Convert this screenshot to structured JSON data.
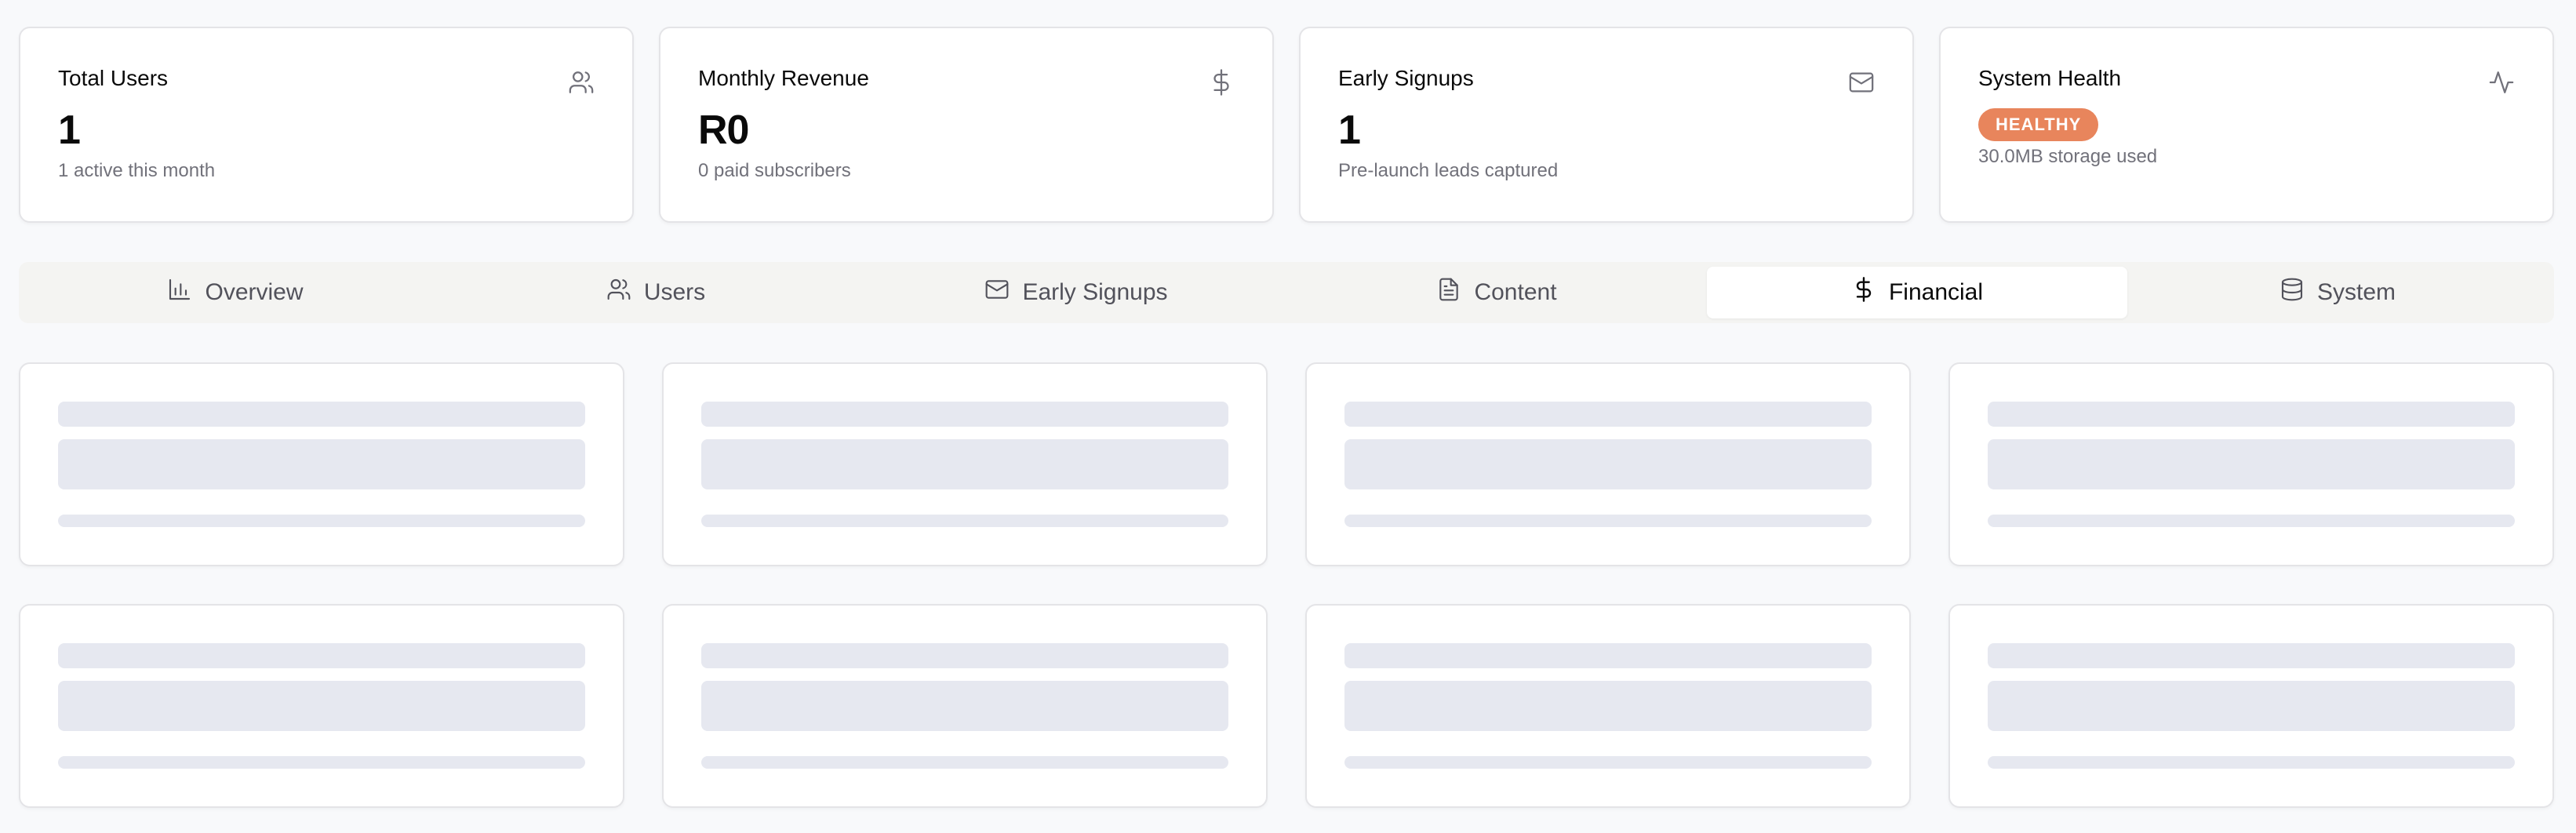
{
  "stats": [
    {
      "title": "Total Users",
      "value": "1",
      "sub": "1 active this month",
      "icon": "users-icon"
    },
    {
      "title": "Monthly Revenue",
      "value": "R0",
      "sub": "0 paid subscribers",
      "icon": "dollar-icon"
    },
    {
      "title": "Early Signups",
      "value": "1",
      "sub": "Pre-launch leads captured",
      "icon": "mail-icon"
    },
    {
      "title": "System Health",
      "badge": "HEALTHY",
      "sub": "30.0MB storage used",
      "icon": "activity-icon"
    }
  ],
  "tabs": [
    {
      "label": "Overview",
      "icon": "bar-chart-icon"
    },
    {
      "label": "Users",
      "icon": "users-icon"
    },
    {
      "label": "Early Signups",
      "icon": "mail-icon"
    },
    {
      "label": "Content",
      "icon": "file-text-icon"
    },
    {
      "label": "Financial",
      "icon": "dollar-icon",
      "active": true
    },
    {
      "label": "System",
      "icon": "database-icon"
    }
  ],
  "colors": {
    "accent_badge": "#e8855c",
    "skeleton": "#e6e8f0",
    "background": "#f8f9fb"
  },
  "skeleton_cards": 8
}
